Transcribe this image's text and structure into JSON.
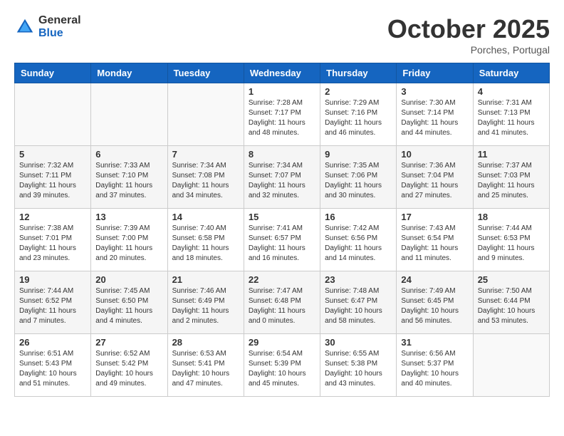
{
  "header": {
    "logo_general": "General",
    "logo_blue": "Blue",
    "month_title": "October 2025",
    "location": "Porches, Portugal"
  },
  "weekdays": [
    "Sunday",
    "Monday",
    "Tuesday",
    "Wednesday",
    "Thursday",
    "Friday",
    "Saturday"
  ],
  "weeks": [
    [
      {
        "day": "",
        "info": ""
      },
      {
        "day": "",
        "info": ""
      },
      {
        "day": "",
        "info": ""
      },
      {
        "day": "1",
        "info": "Sunrise: 7:28 AM\nSunset: 7:17 PM\nDaylight: 11 hours\nand 48 minutes."
      },
      {
        "day": "2",
        "info": "Sunrise: 7:29 AM\nSunset: 7:16 PM\nDaylight: 11 hours\nand 46 minutes."
      },
      {
        "day": "3",
        "info": "Sunrise: 7:30 AM\nSunset: 7:14 PM\nDaylight: 11 hours\nand 44 minutes."
      },
      {
        "day": "4",
        "info": "Sunrise: 7:31 AM\nSunset: 7:13 PM\nDaylight: 11 hours\nand 41 minutes."
      }
    ],
    [
      {
        "day": "5",
        "info": "Sunrise: 7:32 AM\nSunset: 7:11 PM\nDaylight: 11 hours\nand 39 minutes."
      },
      {
        "day": "6",
        "info": "Sunrise: 7:33 AM\nSunset: 7:10 PM\nDaylight: 11 hours\nand 37 minutes."
      },
      {
        "day": "7",
        "info": "Sunrise: 7:34 AM\nSunset: 7:08 PM\nDaylight: 11 hours\nand 34 minutes."
      },
      {
        "day": "8",
        "info": "Sunrise: 7:34 AM\nSunset: 7:07 PM\nDaylight: 11 hours\nand 32 minutes."
      },
      {
        "day": "9",
        "info": "Sunrise: 7:35 AM\nSunset: 7:06 PM\nDaylight: 11 hours\nand 30 minutes."
      },
      {
        "day": "10",
        "info": "Sunrise: 7:36 AM\nSunset: 7:04 PM\nDaylight: 11 hours\nand 27 minutes."
      },
      {
        "day": "11",
        "info": "Sunrise: 7:37 AM\nSunset: 7:03 PM\nDaylight: 11 hours\nand 25 minutes."
      }
    ],
    [
      {
        "day": "12",
        "info": "Sunrise: 7:38 AM\nSunset: 7:01 PM\nDaylight: 11 hours\nand 23 minutes."
      },
      {
        "day": "13",
        "info": "Sunrise: 7:39 AM\nSunset: 7:00 PM\nDaylight: 11 hours\nand 20 minutes."
      },
      {
        "day": "14",
        "info": "Sunrise: 7:40 AM\nSunset: 6:58 PM\nDaylight: 11 hours\nand 18 minutes."
      },
      {
        "day": "15",
        "info": "Sunrise: 7:41 AM\nSunset: 6:57 PM\nDaylight: 11 hours\nand 16 minutes."
      },
      {
        "day": "16",
        "info": "Sunrise: 7:42 AM\nSunset: 6:56 PM\nDaylight: 11 hours\nand 14 minutes."
      },
      {
        "day": "17",
        "info": "Sunrise: 7:43 AM\nSunset: 6:54 PM\nDaylight: 11 hours\nand 11 minutes."
      },
      {
        "day": "18",
        "info": "Sunrise: 7:44 AM\nSunset: 6:53 PM\nDaylight: 11 hours\nand 9 minutes."
      }
    ],
    [
      {
        "day": "19",
        "info": "Sunrise: 7:44 AM\nSunset: 6:52 PM\nDaylight: 11 hours\nand 7 minutes."
      },
      {
        "day": "20",
        "info": "Sunrise: 7:45 AM\nSunset: 6:50 PM\nDaylight: 11 hours\nand 4 minutes."
      },
      {
        "day": "21",
        "info": "Sunrise: 7:46 AM\nSunset: 6:49 PM\nDaylight: 11 hours\nand 2 minutes."
      },
      {
        "day": "22",
        "info": "Sunrise: 7:47 AM\nSunset: 6:48 PM\nDaylight: 11 hours\nand 0 minutes."
      },
      {
        "day": "23",
        "info": "Sunrise: 7:48 AM\nSunset: 6:47 PM\nDaylight: 10 hours\nand 58 minutes."
      },
      {
        "day": "24",
        "info": "Sunrise: 7:49 AM\nSunset: 6:45 PM\nDaylight: 10 hours\nand 56 minutes."
      },
      {
        "day": "25",
        "info": "Sunrise: 7:50 AM\nSunset: 6:44 PM\nDaylight: 10 hours\nand 53 minutes."
      }
    ],
    [
      {
        "day": "26",
        "info": "Sunrise: 6:51 AM\nSunset: 5:43 PM\nDaylight: 10 hours\nand 51 minutes."
      },
      {
        "day": "27",
        "info": "Sunrise: 6:52 AM\nSunset: 5:42 PM\nDaylight: 10 hours\nand 49 minutes."
      },
      {
        "day": "28",
        "info": "Sunrise: 6:53 AM\nSunset: 5:41 PM\nDaylight: 10 hours\nand 47 minutes."
      },
      {
        "day": "29",
        "info": "Sunrise: 6:54 AM\nSunset: 5:39 PM\nDaylight: 10 hours\nand 45 minutes."
      },
      {
        "day": "30",
        "info": "Sunrise: 6:55 AM\nSunset: 5:38 PM\nDaylight: 10 hours\nand 43 minutes."
      },
      {
        "day": "31",
        "info": "Sunrise: 6:56 AM\nSunset: 5:37 PM\nDaylight: 10 hours\nand 40 minutes."
      },
      {
        "day": "",
        "info": ""
      }
    ]
  ]
}
